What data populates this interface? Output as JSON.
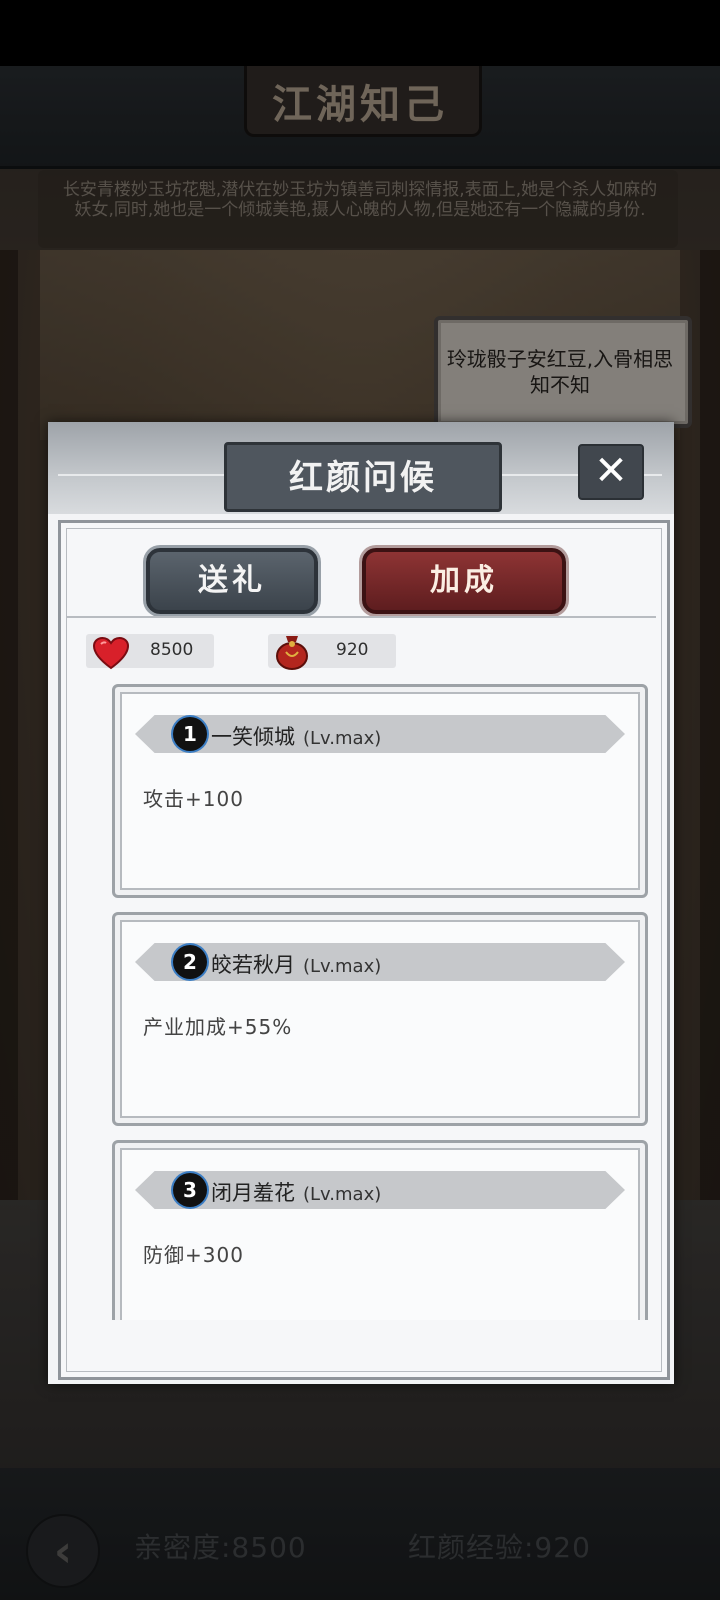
{
  "page": {
    "title": "江湖知己",
    "description": "长安青楼妙玉坊花魁,潜伏在妙玉坊为镇善司刺探情报,表面上,她是个杀人如麻的妖女,同时,她也是一个倾城美艳,摄人心魄的人物,但是她还有一个隐藏的身份.",
    "speech_bubble": "玲珑骰子安红豆,入骨相思知不知"
  },
  "modal": {
    "title": "红颜问候",
    "close_label": "✕",
    "tabs": [
      {
        "label": "送礼",
        "active": false
      },
      {
        "label": "加成",
        "active": true
      }
    ],
    "resources": {
      "intimacy_value": "8500",
      "exp_value": "920"
    },
    "bonuses": [
      {
        "number": "1",
        "name": "一笑倾城",
        "level": "(Lv.max)",
        "effect": "攻击+100"
      },
      {
        "number": "2",
        "name": "皎若秋月",
        "level": "(Lv.max)",
        "effect": "产业加成+55%"
      },
      {
        "number": "3",
        "name": "闭月羞花",
        "level": "(Lv.max)",
        "effect": "防御+300"
      }
    ]
  },
  "bottom_bar": {
    "back_label": "‹",
    "intimacy_text": "亲密度:8500",
    "exp_text": "红颜经验:920"
  },
  "colors": {
    "active_tab": "#8e3434",
    "inactive_tab": "#4f565e",
    "heart": "#d8202a",
    "bag": "#b3261e"
  }
}
